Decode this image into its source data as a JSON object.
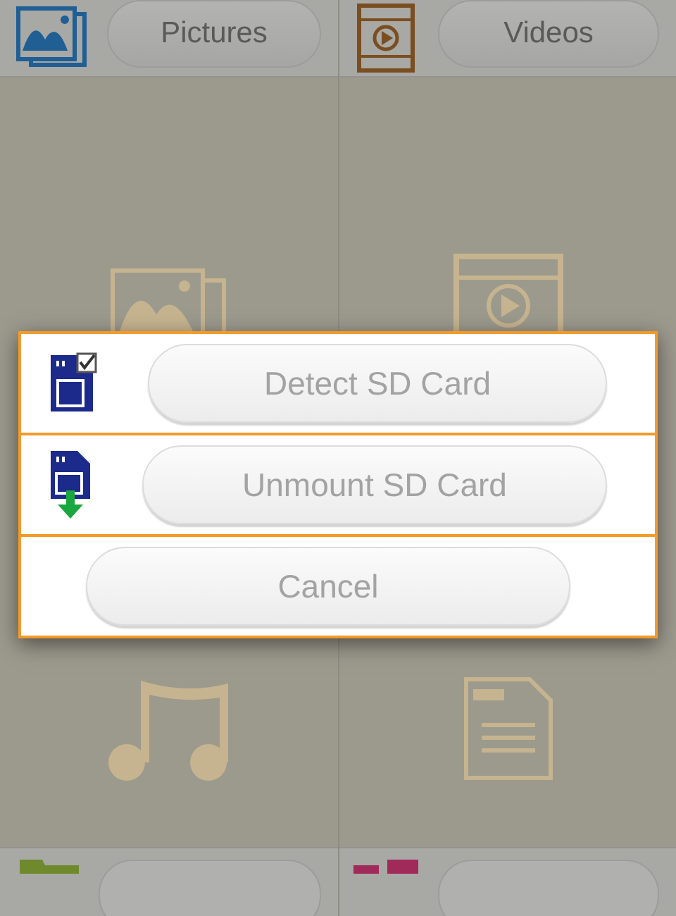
{
  "categories": [
    {
      "label": "Pictures",
      "kind": "pictures"
    },
    {
      "label": "Videos",
      "kind": "videos"
    }
  ],
  "lower_categories": [
    {
      "kind": "music"
    },
    {
      "kind": "documents"
    }
  ],
  "bottom_categories": [
    {
      "kind": "folder"
    },
    {
      "kind": "apps"
    }
  ],
  "dialog": {
    "options": [
      {
        "label": "Detect SD Card",
        "kind": "detect"
      },
      {
        "label": "Unmount SD Card",
        "kind": "unmount"
      },
      {
        "label": "Cancel",
        "kind": "cancel"
      }
    ]
  }
}
